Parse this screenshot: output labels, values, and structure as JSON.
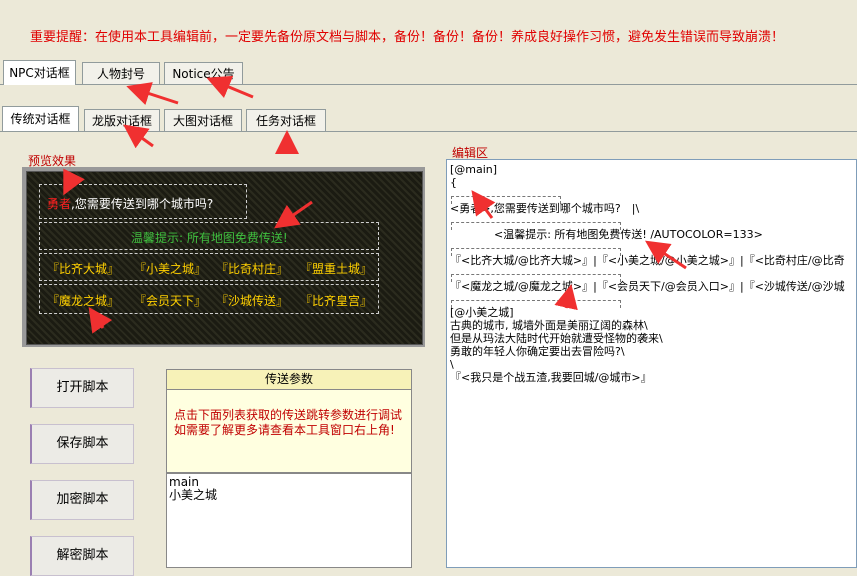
{
  "warning": "重要提醒：在使用本工具编辑前，一定要先备份原文档与脚本，备份！备份！备份！养成良好操作习惯，避免发生错误而导致崩溃！",
  "top_tabs": [
    "NPC对话框",
    "人物封号",
    "Notice公告"
  ],
  "sub_tabs": [
    "传统对话框",
    "龙版对话框",
    "大图对话框",
    "任务对话框"
  ],
  "preview": {
    "label": "预览效果",
    "greeting_name": "勇者",
    "greeting_rest": ",您需要传送到哪个城市吗?",
    "hint": "温馨提示: 所有地图免费传送!",
    "row1": [
      "『比齐大城』",
      "『小美之城』",
      "『比奇村庄』",
      "『盟重土城』"
    ],
    "row2": [
      "『魔龙之城』",
      "『会员天下』",
      "『沙城传送』",
      "『比齐皇宫』"
    ]
  },
  "buttons": {
    "open": "打开脚本",
    "save": "保存脚本",
    "encrypt": "加密脚本",
    "decrypt": "解密脚本"
  },
  "params": {
    "title": "传送参数",
    "hint": "点击下面列表获取的传送跳转参数进行调试　　　　　　如需要了解更多请查看本工具窗口右上角!",
    "list": [
      "main",
      "小美之城"
    ]
  },
  "editor": {
    "label": "编辑区",
    "lines": [
      "[@main]",
      "{",
      "",
      "<勇者>,您需要传送到哪个城市吗?　|\\",
      "",
      "　　　　<温馨提示: 所有地图免费传送! /AUTOCOLOR=133>",
      "",
      "『<比齐大城/@比齐大城>』|『<小美之城/@小美之城>』|『<比奇村庄/@比奇",
      "",
      "『<魔龙之城/@魔龙之城>』|『<会员天下/@会员入口>』|『<沙城传送/@沙城",
      "",
      "[@小美之城]",
      "古典的城市, 城墙外面是美丽辽阔的森林\\",
      "但是从玛法大陆时代开始就遭受怪物的袭来\\",
      "勇敢的年轻人你确定要出去冒险吗?\\",
      "\\",
      "『<我只是个战五渣,我要回城/@城市>』"
    ]
  },
  "colors": {
    "warning": "#e00000",
    "accent_red": "#c00000",
    "yellow_text": "#ffd000",
    "green_text": "#3fbf3f"
  }
}
